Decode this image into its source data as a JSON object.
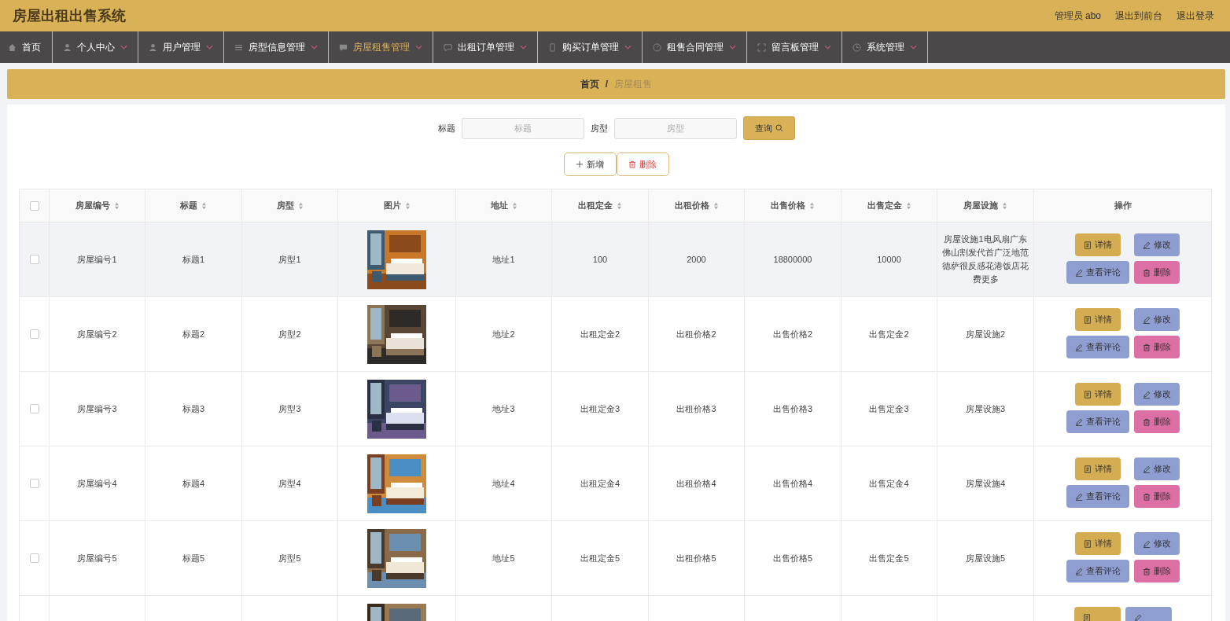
{
  "header": {
    "title": "房屋出租出售系统",
    "links": [
      "管理员 abo",
      "退出到前台",
      "退出登录"
    ]
  },
  "nav": [
    {
      "label": "首页",
      "selected": false,
      "has_menu": false
    },
    {
      "label": "个人中心",
      "selected": false,
      "has_menu": true
    },
    {
      "label": "用户管理",
      "selected": false,
      "has_menu": true
    },
    {
      "label": "房型信息管理",
      "selected": false,
      "has_menu": true
    },
    {
      "label": "房屋租售管理",
      "selected": true,
      "has_menu": true
    },
    {
      "label": "出租订单管理",
      "selected": false,
      "has_menu": true
    },
    {
      "label": "购买订单管理",
      "selected": false,
      "has_menu": true
    },
    {
      "label": "租售合同管理",
      "selected": false,
      "has_menu": true
    },
    {
      "label": "留言板管理",
      "selected": false,
      "has_menu": true
    },
    {
      "label": "系统管理",
      "selected": false,
      "has_menu": true
    }
  ],
  "breadcrumb": {
    "items": [
      "首页",
      "房屋租售"
    ],
    "separator": "/"
  },
  "search": {
    "fields": [
      {
        "label": "标题",
        "placeholder": "标题"
      },
      {
        "label": "房型",
        "placeholder": "房型"
      }
    ],
    "button": "查询"
  },
  "actions": {
    "add": "新增",
    "delete": "删除"
  },
  "table": {
    "select_all_checked": false,
    "columns": [
      "房屋编号",
      "标题",
      "房型",
      "图片",
      "地址",
      "出租定金",
      "出租价格",
      "出售价格",
      "出售定金",
      "房屋设施"
    ],
    "action_column": "操作",
    "rows": [
      {
        "hovered": true,
        "checked": false,
        "cells": [
          "房屋编号1",
          "标题1",
          "房型1",
          null,
          "地址1",
          "100",
          "2000",
          "18800000",
          "10000",
          "房屋设施1电风扇广东佛山割发代首广泛地范德萨很反感花港饭店花费更多"
        ],
        "buttons": [
          "详情",
          "修改",
          "查看评论",
          "删除"
        ]
      },
      {
        "hovered": false,
        "checked": false,
        "cells": [
          "房屋编号2",
          "标题2",
          "房型2",
          null,
          "地址2",
          "出租定金2",
          "出租价格2",
          "出售价格2",
          "出售定金2",
          "房屋设施2"
        ],
        "buttons": [
          "详情",
          "修改",
          "查看评论",
          "删除"
        ]
      },
      {
        "hovered": false,
        "checked": false,
        "cells": [
          "房屋编号3",
          "标题3",
          "房型3",
          null,
          "地址3",
          "出租定金3",
          "出租价格3",
          "出售价格3",
          "出售定金3",
          "房屋设施3"
        ],
        "buttons": [
          "详情",
          "修改",
          "查看评论",
          "删除"
        ]
      },
      {
        "hovered": false,
        "checked": false,
        "cells": [
          "房屋编号4",
          "标题4",
          "房型4",
          null,
          "地址4",
          "出租定金4",
          "出租价格4",
          "出售价格4",
          "出售定金4",
          "房屋设施4"
        ],
        "buttons": [
          "详情",
          "修改",
          "查看评论",
          "删除"
        ]
      },
      {
        "hovered": false,
        "checked": false,
        "cells": [
          "房屋编号5",
          "标题5",
          "房型5",
          null,
          "地址5",
          "出租定金5",
          "出租价格5",
          "出售价格5",
          "出售定金5",
          "房屋设施5"
        ],
        "buttons": [
          "详情",
          "修改",
          "查看评论",
          "删除"
        ]
      },
      {
        "kind": "cut",
        "hovered": false,
        "cells": [
          "",
          "",
          "",
          null,
          "",
          "",
          "",
          "",
          "",
          ""
        ]
      }
    ]
  }
}
